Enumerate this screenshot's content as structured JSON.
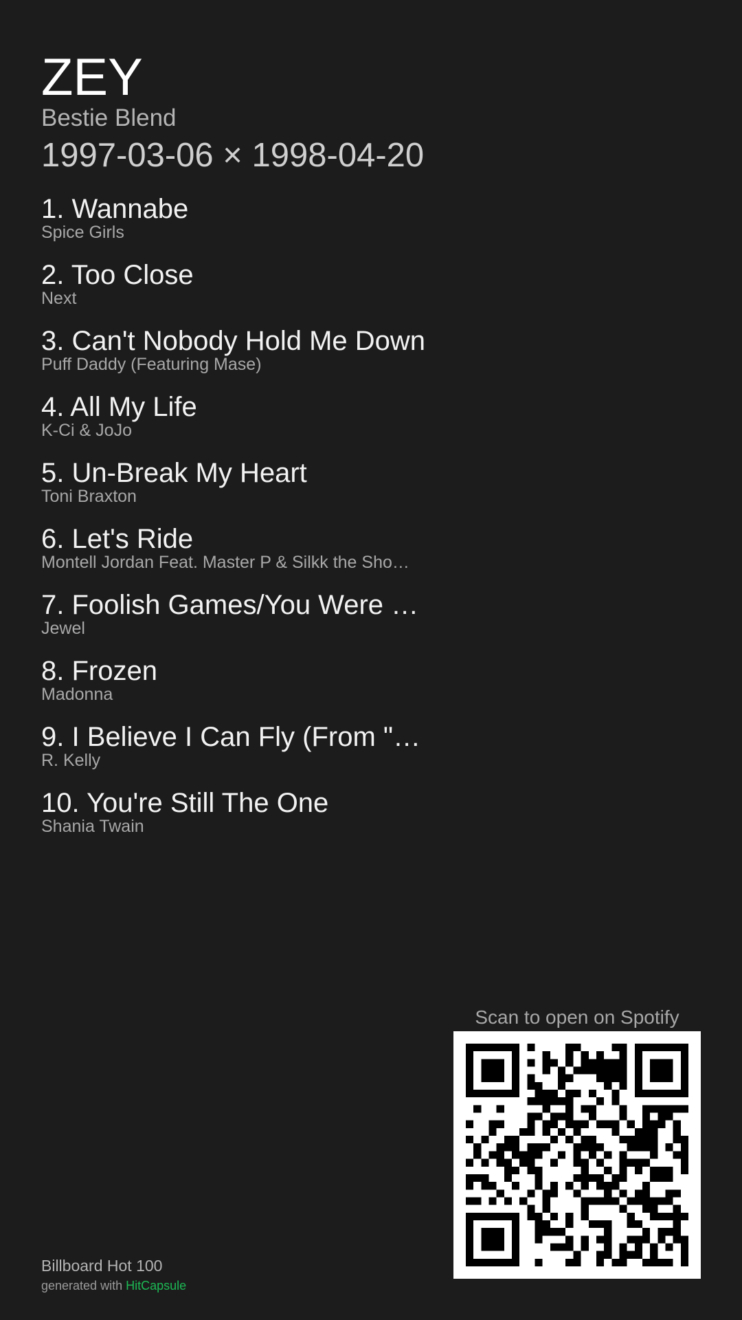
{
  "header": {
    "title": "ZEY",
    "subtitle": "Bestie Blend",
    "dates": "1997-03-06 × 1998-04-20"
  },
  "tracks": [
    {
      "label": "1. Wannabe",
      "artist": "Spice Girls"
    },
    {
      "label": "2. Too Close",
      "artist": "Next"
    },
    {
      "label": "3. Can't Nobody Hold Me Down",
      "artist": "Puff Daddy (Featuring Mase)"
    },
    {
      "label": "4. All My Life",
      "artist": "K-Ci & JoJo"
    },
    {
      "label": "5. Un-Break My Heart",
      "artist": "Toni Braxton"
    },
    {
      "label": "6. Let's Ride",
      "artist": "Montell Jordan Feat. Master P & Silkk the Sho…"
    },
    {
      "label": "7. Foolish Games/You Were …",
      "artist": "Jewel"
    },
    {
      "label": "8. Frozen",
      "artist": "Madonna"
    },
    {
      "label": "9. I Believe I Can Fly (From \"…",
      "artist": "R. Kelly"
    },
    {
      "label": "10. You're Still The One",
      "artist": "Shania Twain"
    }
  ],
  "qr": {
    "label": "Scan to open on Spotify",
    "icon": "qr-code-icon"
  },
  "footer": {
    "chart": "Billboard Hot 100",
    "generated_prefix": "generated with ",
    "brand": "HitCapsule"
  },
  "colors": {
    "background": "#1c1c1c",
    "brand": "#1db954"
  }
}
